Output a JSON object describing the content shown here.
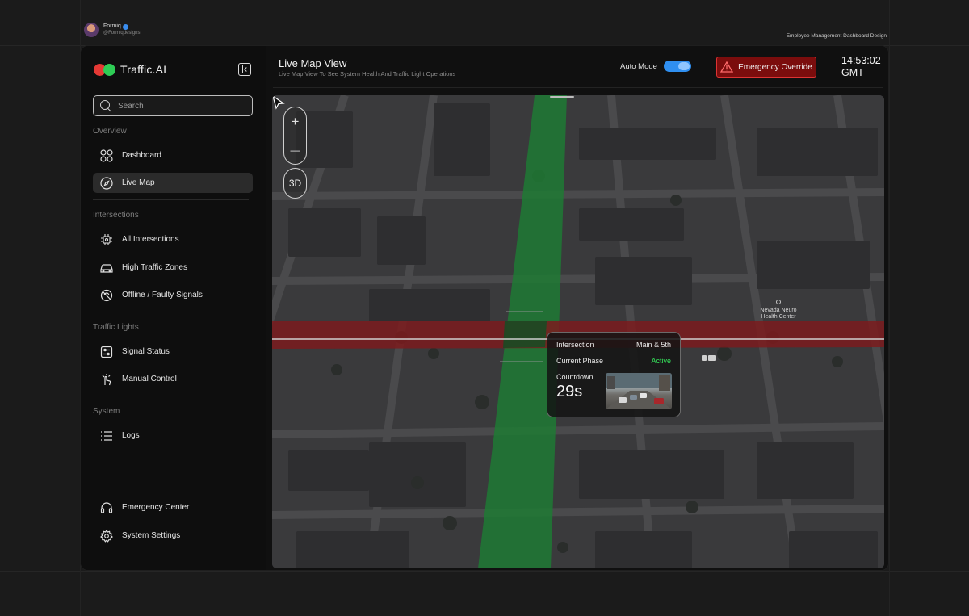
{
  "author": {
    "name": "Formiq",
    "handle": "@Formiqdesigns"
  },
  "design_label": "Employee Management Dashboard Design",
  "sidebar": {
    "brand": "Traffic.AI",
    "search_placeholder": "Search",
    "sections": {
      "overview": "Overview",
      "intersections": "Intersections",
      "traffic_lights": "Traffic Lights",
      "system": "System"
    },
    "items": {
      "dashboard": "Dashboard",
      "live_map": "Live Map",
      "all_intersections": "All Intersections",
      "high_traffic_zones": "High Traffic Zones",
      "offline_faulty_signals": "Offline / Faulty Signals",
      "signal_status": "Signal Status",
      "manual_control": "Manual Control",
      "logs": "Logs",
      "emergency_center": "Emergency Center",
      "system_settings": "System Settings"
    },
    "active_item": "Live Map"
  },
  "header": {
    "title": "Live Map View",
    "subtitle": "Live Map View To See System Health And Traffic Light Operations",
    "auto_mode_label": "Auto Mode",
    "auto_mode_on": true,
    "emergency_label": "Emergency Override",
    "time": "14:53:02",
    "timezone": "GMT"
  },
  "map": {
    "zoom_in": "+",
    "zoom_out": "—",
    "view_3d": "3D",
    "poi_label": "Nevada Neuro Health Center",
    "tooltip": {
      "intersection_label": "Intersection",
      "intersection_value": "Main & 5th",
      "phase_label": "Current Phase",
      "phase_value": "Active",
      "countdown_label": "Countdown",
      "countdown_value": "29s"
    }
  },
  "colors": {
    "accent_green": "#2ecc55",
    "accent_red": "#e53935",
    "toggle_blue": "#2f8ff0",
    "emergency_bg": "#7b0d0d"
  }
}
